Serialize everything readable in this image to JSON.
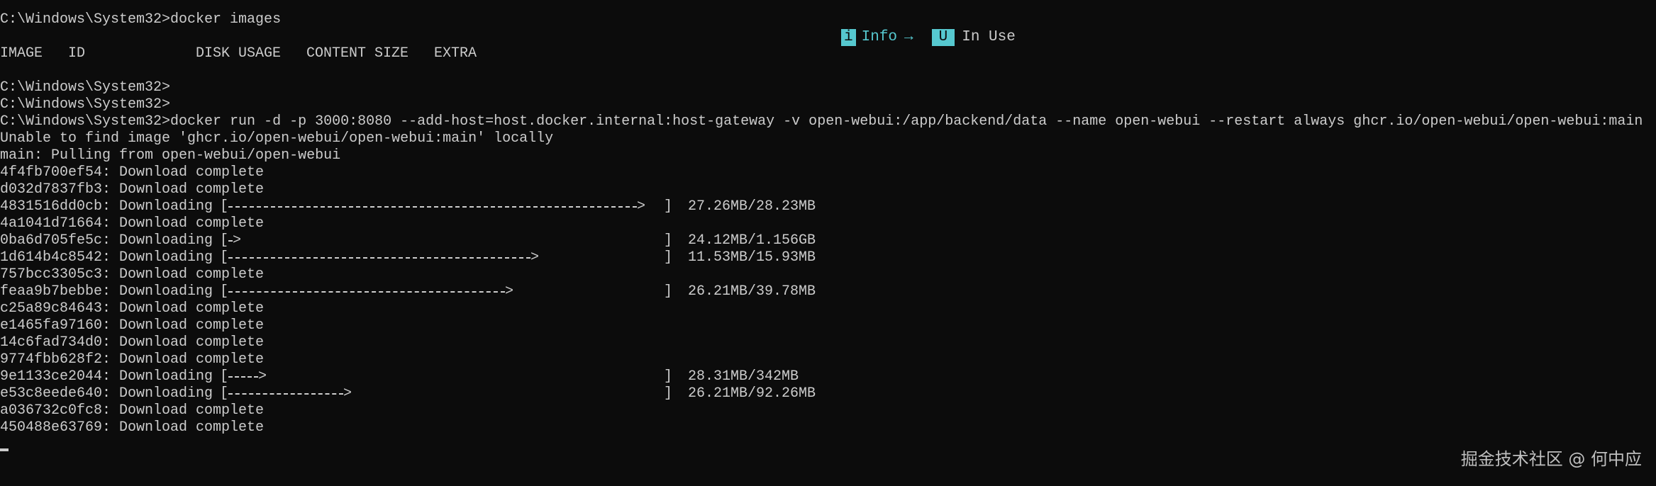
{
  "prompt": "C:\\Windows\\System32>",
  "lines": {
    "cmd_images": "C:\\Windows\\System32>docker images",
    "prompt_1": "C:\\Windows\\System32>",
    "prompt_2": "C:\\Windows\\System32>",
    "cmd_run": "C:\\Windows\\System32>docker run -d -p 3000:8080 --add-host=host.docker.internal:host-gateway -v open-webui:/app/backend/data --name open-webui --restart always ghcr.io/open-webui/open-webui:main",
    "unable": "Unable to find image 'ghcr.io/open-webui/open-webui:main' locally",
    "pulling": "main: Pulling from open-webui/open-webui"
  },
  "columns": [
    "IMAGE",
    "ID",
    "DISK USAGE",
    "CONTENT SIZE",
    "EXTRA"
  ],
  "legend": {
    "info_badge": "i",
    "info_label": "Info",
    "arrow": "→",
    "inuse_badge": "U",
    "inuse_label": "In Use"
  },
  "layers": [
    {
      "id": "4f4fb700ef54",
      "status": "Download complete"
    },
    {
      "id": "d032d7837fb3",
      "status": "Download complete"
    },
    {
      "id": "4831516dd0cb",
      "status": "Downloading",
      "open": "[",
      "arrow": ">",
      "close": "]",
      "progress": 0.97,
      "size": "27.26MB/28.23MB"
    },
    {
      "id": "4a1041d71664",
      "status": "Download complete"
    },
    {
      "id": "0ba6d705fe5c",
      "status": "Downloading",
      "open": "[",
      "arrow": ">",
      "close": "]",
      "progress": 0.02,
      "size": "24.12MB/1.156GB"
    },
    {
      "id": "1d614b4c8542",
      "status": "Downloading",
      "open": "[",
      "arrow": ">",
      "close": "]",
      "progress": 0.72,
      "size": "11.53MB/15.93MB"
    },
    {
      "id": "757bcc3305c3",
      "status": "Download complete"
    },
    {
      "id": "feaa9b7bebbe",
      "status": "Downloading",
      "open": "[",
      "arrow": ">",
      "close": "]",
      "progress": 0.66,
      "size": "26.21MB/39.78MB"
    },
    {
      "id": "c25a89c84643",
      "status": "Download complete"
    },
    {
      "id": "e1465fa97160",
      "status": "Download complete"
    },
    {
      "id": "14c6fad734d0",
      "status": "Download complete"
    },
    {
      "id": "9774fbb628f2",
      "status": "Download complete"
    },
    {
      "id": "9e1133ce2044",
      "status": "Downloading",
      "open": "[",
      "arrow": ">",
      "close": "]",
      "progress": 0.08,
      "size": "28.31MB/342MB"
    },
    {
      "id": "e53c8eede640",
      "status": "Downloading",
      "open": "[",
      "arrow": ">",
      "close": "]",
      "progress": 0.28,
      "size": "26.21MB/92.26MB"
    },
    {
      "id": "a036732c0fc8",
      "status": "Download complete"
    },
    {
      "id": "450488e63769",
      "status": "Download complete"
    }
  ],
  "watermark": "掘金技术社区 @ 何中应",
  "colors": {
    "background": "#0c0c0c",
    "text": "#cccccc",
    "accent": "#56c8cf"
  }
}
